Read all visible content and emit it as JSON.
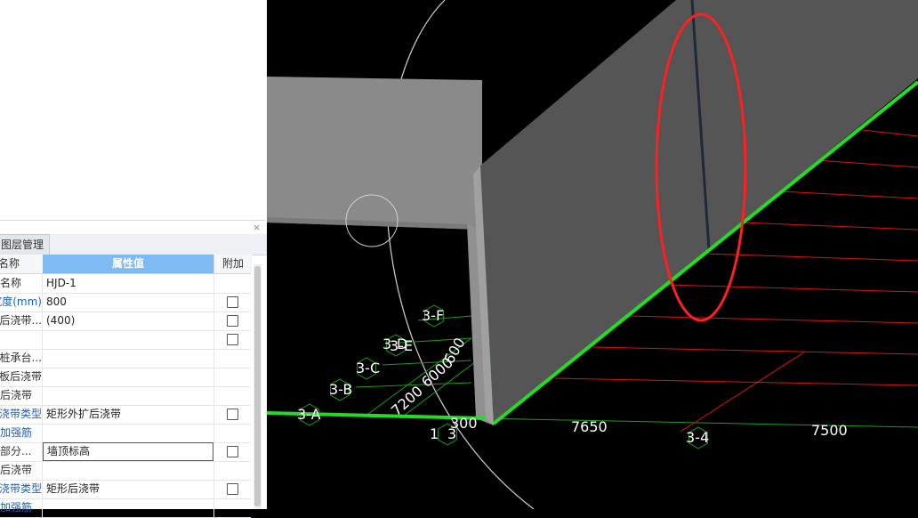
{
  "panel": {
    "close_glyph": "×",
    "tab_label": "图层管理",
    "headers": {
      "name": "名称",
      "value": "属性值",
      "add": "附加"
    },
    "rows": [
      {
        "name": "名称",
        "value": "HJD-1",
        "blue": false,
        "checkbox": false,
        "editing": false
      },
      {
        "name": "宽度(mm)",
        "value": "800",
        "blue": true,
        "checkbox": true,
        "editing": false
      },
      {
        "name": "后浇带...",
        "value": "(400)",
        "blue": false,
        "checkbox": true,
        "editing": false
      },
      {
        "name": "",
        "value": "",
        "blue": false,
        "checkbox": true,
        "editing": false
      },
      {
        "name": "桩承台...",
        "value": "",
        "blue": false,
        "checkbox": false,
        "editing": false
      },
      {
        "name": "板后浇带",
        "value": "",
        "blue": false,
        "checkbox": false,
        "editing": false
      },
      {
        "name": "后浇带",
        "value": "",
        "blue": false,
        "checkbox": false,
        "editing": false
      },
      {
        "name": "浇带类型",
        "value": "矩形外扩后浇带",
        "blue": true,
        "checkbox": true,
        "editing": false
      },
      {
        "name": "加强筋",
        "value": "",
        "blue": true,
        "checkbox": false,
        "editing": false
      },
      {
        "name": "部分...",
        "value": "墙顶标高",
        "blue": false,
        "checkbox": true,
        "editing": true
      },
      {
        "name": "后浇带",
        "value": "",
        "blue": false,
        "checkbox": false,
        "editing": false
      },
      {
        "name": "浇带类型",
        "value": "矩形后浇带",
        "blue": true,
        "checkbox": true,
        "editing": false
      },
      {
        "name": "加强筋",
        "value": "",
        "blue": true,
        "checkbox": false,
        "editing": false
      }
    ]
  },
  "viewport": {
    "axis_labels": [
      {
        "key": "f",
        "text": "3-F"
      },
      {
        "key": "d",
        "text": "3-D"
      },
      {
        "key": "e",
        "text": "3-E"
      },
      {
        "key": "c",
        "text": "3-C"
      },
      {
        "key": "b",
        "text": "3-B"
      },
      {
        "key": "a",
        "text": "3-A"
      },
      {
        "key": "n4",
        "text": "3-4"
      },
      {
        "key": "n1",
        "text": "1"
      },
      {
        "key": "n3",
        "text": "3"
      }
    ],
    "dimensions": [
      {
        "key": "d7200",
        "text": "7200"
      },
      {
        "key": "d6000a",
        "text": "6000"
      },
      {
        "key": "d6000b",
        "text": "600"
      },
      {
        "key": "d300",
        "text": "300"
      },
      {
        "key": "d7650",
        "text": "7650"
      },
      {
        "key": "d7500",
        "text": "7500"
      }
    ],
    "colors": {
      "grid_green": "#22dd22",
      "rebar_red": "#e01010",
      "highlight": "#ff2020",
      "concrete_light": "#8a8a8a",
      "concrete_dark": "#555555"
    }
  }
}
